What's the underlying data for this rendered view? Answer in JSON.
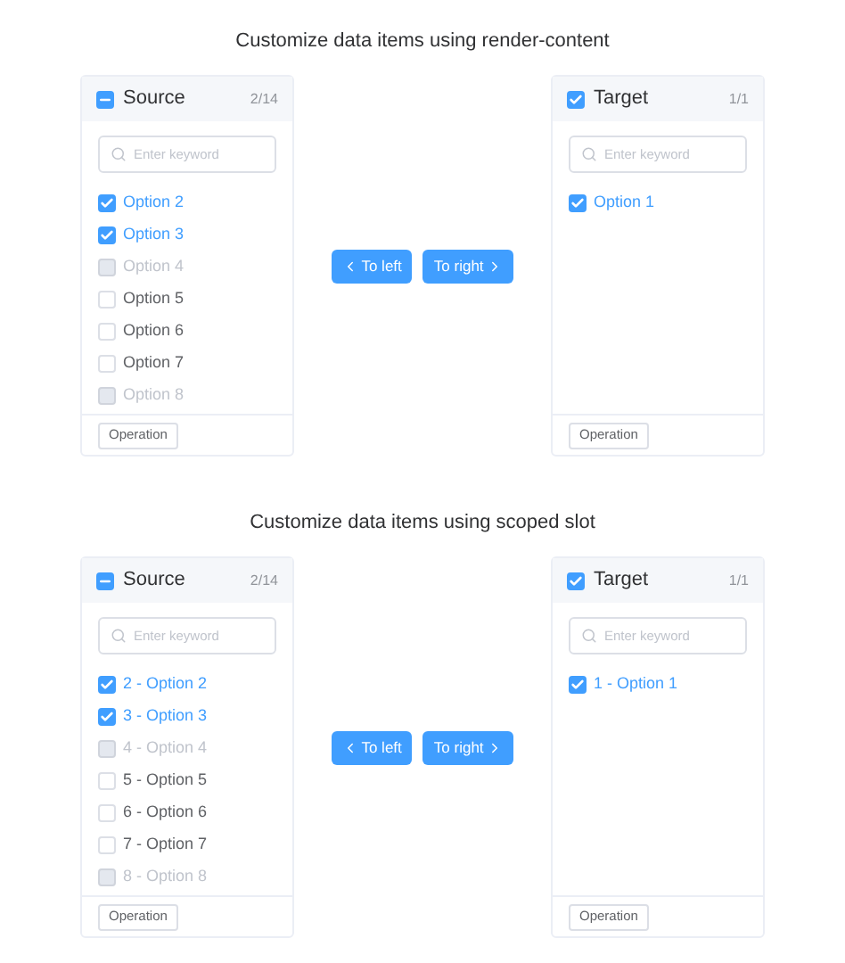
{
  "sections": [
    {
      "title": "Customize data items using render-content",
      "source": {
        "title": "Source",
        "count": "2/14",
        "indeterminate": true,
        "placeholder": "Enter keyword",
        "items": [
          {
            "label": "Option 2",
            "checked": true,
            "disabled": false
          },
          {
            "label": "Option 3",
            "checked": true,
            "disabled": false
          },
          {
            "label": "Option 4",
            "checked": false,
            "disabled": true
          },
          {
            "label": "Option 5",
            "checked": false,
            "disabled": false
          },
          {
            "label": "Option 6",
            "checked": false,
            "disabled": false
          },
          {
            "label": "Option 7",
            "checked": false,
            "disabled": false
          },
          {
            "label": "Option 8",
            "checked": false,
            "disabled": true
          }
        ],
        "footer_button": "Operation"
      },
      "buttons": [
        {
          "label": "To left",
          "kind": "left"
        },
        {
          "label": "To right",
          "kind": "right"
        }
      ],
      "target": {
        "title": "Target",
        "count": "1/1",
        "checked": true,
        "placeholder": "Enter keyword",
        "items": [
          {
            "label": "Option 1",
            "checked": true,
            "disabled": false
          }
        ],
        "footer_button": "Operation"
      }
    },
    {
      "title": "Customize data items using scoped slot",
      "source": {
        "title": "Source",
        "count": "2/14",
        "indeterminate": true,
        "placeholder": "Enter keyword",
        "items": [
          {
            "label": "2 - Option 2",
            "checked": true,
            "disabled": false
          },
          {
            "label": "3 - Option 3",
            "checked": true,
            "disabled": false
          },
          {
            "label": "4 - Option 4",
            "checked": false,
            "disabled": true
          },
          {
            "label": "5 - Option 5",
            "checked": false,
            "disabled": false
          },
          {
            "label": "6 - Option 6",
            "checked": false,
            "disabled": false
          },
          {
            "label": "7 - Option 7",
            "checked": false,
            "disabled": false
          },
          {
            "label": "8 - Option 8",
            "checked": false,
            "disabled": true
          }
        ],
        "footer_button": "Operation"
      },
      "buttons": [
        {
          "label": "To left",
          "kind": "left"
        },
        {
          "label": "To right",
          "kind": "right"
        }
      ],
      "target": {
        "title": "Target",
        "count": "1/1",
        "checked": true,
        "placeholder": "Enter keyword",
        "items": [
          {
            "label": "1 - Option 1",
            "checked": true,
            "disabled": false
          }
        ],
        "footer_button": "Operation"
      }
    }
  ]
}
